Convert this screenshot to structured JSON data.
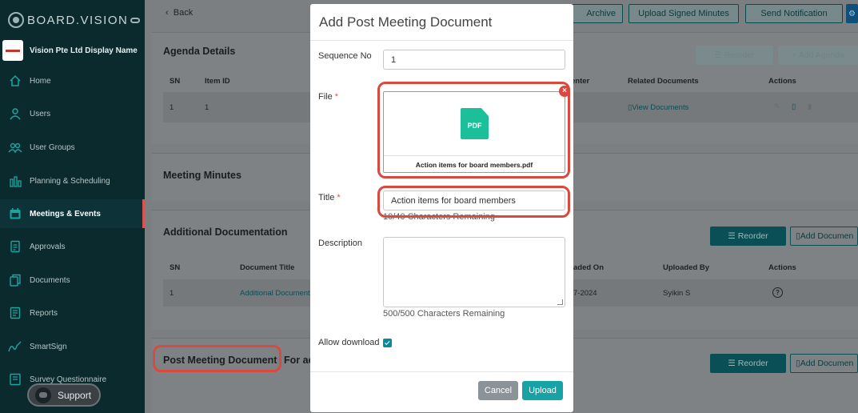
{
  "colors": {
    "sidebar_bg": "#0b2a2e",
    "teal": "#17a2a6",
    "highlight": "#d9493d",
    "checkbox": "#0b8a9c",
    "pdf_icon": "#1bbf9a"
  },
  "sidebar": {
    "brand": "BOARD.VISION",
    "org_name": "Vision Pte Ltd Display Name",
    "items": [
      {
        "label": "Home",
        "icon": "home-icon"
      },
      {
        "label": "Users",
        "icon": "user-icon"
      },
      {
        "label": "User Groups",
        "icon": "user-group-icon"
      },
      {
        "label": "Planning & Scheduling",
        "icon": "chart-bars-icon"
      },
      {
        "label": "Meetings & Events",
        "icon": "calendar-icon",
        "active": true
      },
      {
        "label": "Approvals",
        "icon": "document-check-icon"
      },
      {
        "label": "Documents",
        "icon": "documents-icon"
      },
      {
        "label": "Reports",
        "icon": "report-icon"
      },
      {
        "label": "SmartSign",
        "icon": "signature-icon"
      },
      {
        "label": "Survey Questionnaire",
        "icon": "survey-icon"
      }
    ],
    "support_label": "Support"
  },
  "topbar": {
    "back_label": "Back",
    "buttons": [
      "Archive",
      "Upload Signed Minutes",
      "Send Notification"
    ]
  },
  "agenda": {
    "title": "Agenda Details",
    "reorder_label": "Reorder",
    "add_label": "+ Add Agenda",
    "columns": [
      "SN",
      "Item ID",
      "enter",
      "Related Documents",
      "Actions"
    ],
    "rows": [
      {
        "sn": "1",
        "item_id": "1",
        "related": "View Documents"
      }
    ]
  },
  "minutes": {
    "title": "Meeting Minutes"
  },
  "additional": {
    "title": "Additional Documentation",
    "reorder_label": "Reorder",
    "add_label": "Add Documen",
    "columns": [
      "SN",
      "Document Title",
      "aded On",
      "Uploaded By",
      "Actions"
    ],
    "rows": [
      {
        "sn": "1",
        "title": "Additional Document",
        "date": "7-2024",
        "by": "Syikin S"
      }
    ]
  },
  "post_meeting": {
    "title": "Post Meeting Document",
    "suffix": "For ac",
    "reorder_label": "Reorder",
    "add_label": "Add Documen"
  },
  "modal": {
    "title": "Add Post Meeting Document",
    "sequence_label": "Sequence No",
    "sequence_value": "1",
    "file_label": "File",
    "file_type": "PDF",
    "file_name": "Action items for board members.pdf",
    "remove_symbol": "×",
    "title_label": "Title",
    "title_value": "Action items for board members",
    "title_hint": "10/40 Characters Remaining",
    "description_label": "Description",
    "description_hint": "500/500 Characters Remaining",
    "allow_download_label": "Allow download",
    "allow_download": true,
    "cancel_label": "Cancel",
    "upload_label": "Upload",
    "required_mark": "*"
  }
}
